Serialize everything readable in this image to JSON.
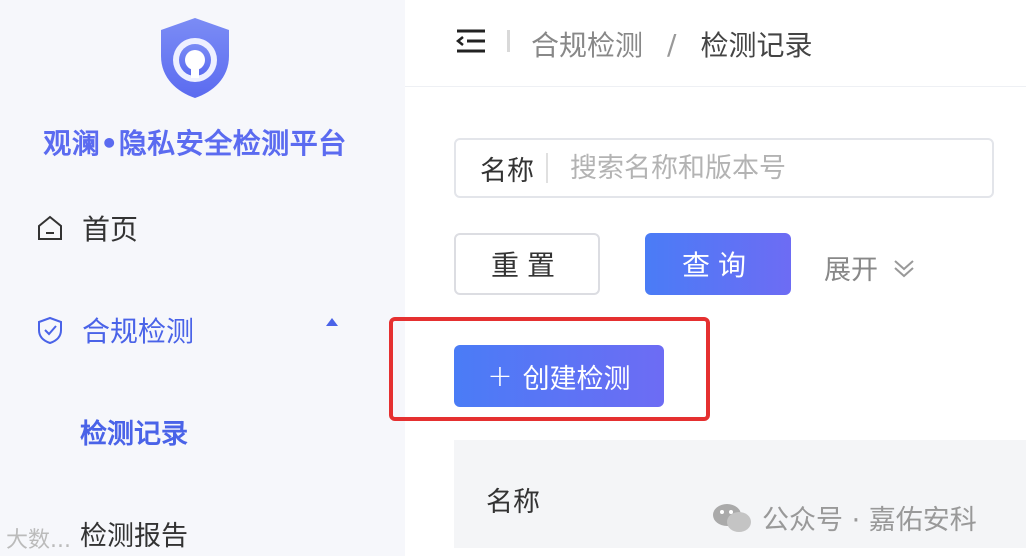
{
  "sidebar": {
    "brand": "观澜•隐私安全检测平台",
    "items": [
      {
        "label": "首页",
        "icon": "home-icon"
      },
      {
        "label": "合规检测",
        "icon": "shield-check-icon"
      }
    ],
    "sub_items": [
      {
        "label": "检测记录"
      },
      {
        "label": "检测报告"
      }
    ]
  },
  "header": {
    "breadcrumb": [
      "合规检测",
      "检测记录"
    ],
    "separator": "/"
  },
  "search": {
    "label": "名称",
    "placeholder": "搜索名称和版本号"
  },
  "buttons": {
    "reset": "重置",
    "query": "查询",
    "expand": "展开",
    "create_plus": "+",
    "create": "创建检测"
  },
  "table": {
    "columns": [
      "名称"
    ]
  },
  "watermark": {
    "right": "公众号 · 嘉佑安科",
    "left": "大数..."
  },
  "colors": {
    "accent": "#4a63e8",
    "button_gradient_start": "#4a7cf6",
    "button_gradient_end": "#6d6cf4",
    "highlight": "#e53030",
    "sidebar_bg": "#f6f7fb"
  }
}
